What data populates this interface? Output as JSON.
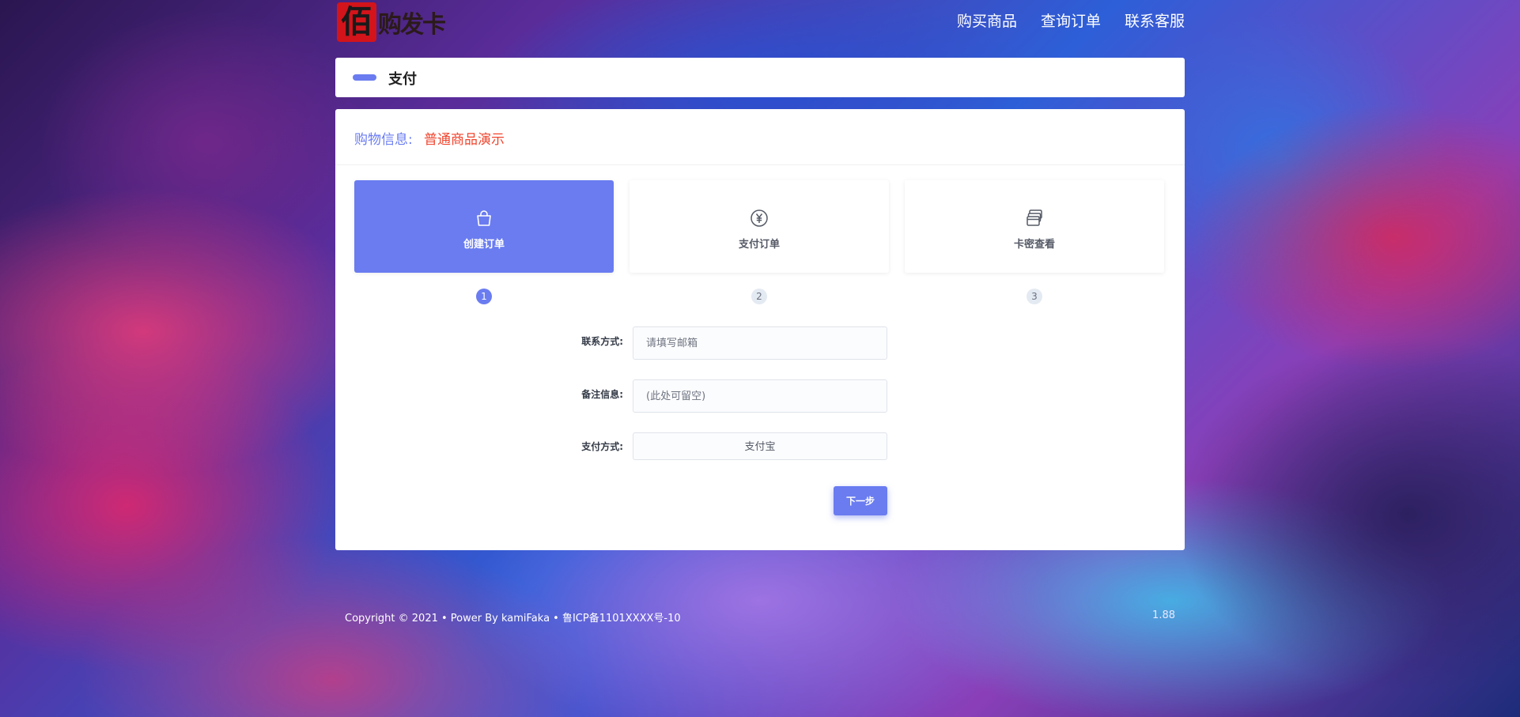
{
  "logo": {
    "mark": "佰",
    "text": "购发卡"
  },
  "nav": {
    "items": [
      {
        "label": "购买商品"
      },
      {
        "label": "查询订单"
      },
      {
        "label": "联系客服"
      }
    ]
  },
  "header": {
    "title": "支付"
  },
  "info": {
    "label": "购物信息:",
    "value": "普通商品演示"
  },
  "steps": [
    {
      "label": "创建订单",
      "number": "1",
      "icon": "shopping-bag-icon",
      "active": true
    },
    {
      "label": "支付订单",
      "number": "2",
      "icon": "yen-coin-icon",
      "active": false
    },
    {
      "label": "卡密查看",
      "number": "3",
      "icon": "cards-stack-icon",
      "active": false
    }
  ],
  "form": {
    "contact_label": "联系方式:",
    "contact_placeholder": "请填写邮箱",
    "remark_label": "备注信息:",
    "remark_placeholder": "(此处可留空)",
    "payment_label": "支付方式:",
    "payment_value": "支付宝",
    "next_label": "下一步"
  },
  "footer": {
    "text": "Copyright © 2021 • Power By kamiFaka • 鲁ICP备1101XXXX号-10",
    "version": "1.88"
  },
  "colors": {
    "accent": "#6a7cf0",
    "highlight": "#f0452e"
  }
}
